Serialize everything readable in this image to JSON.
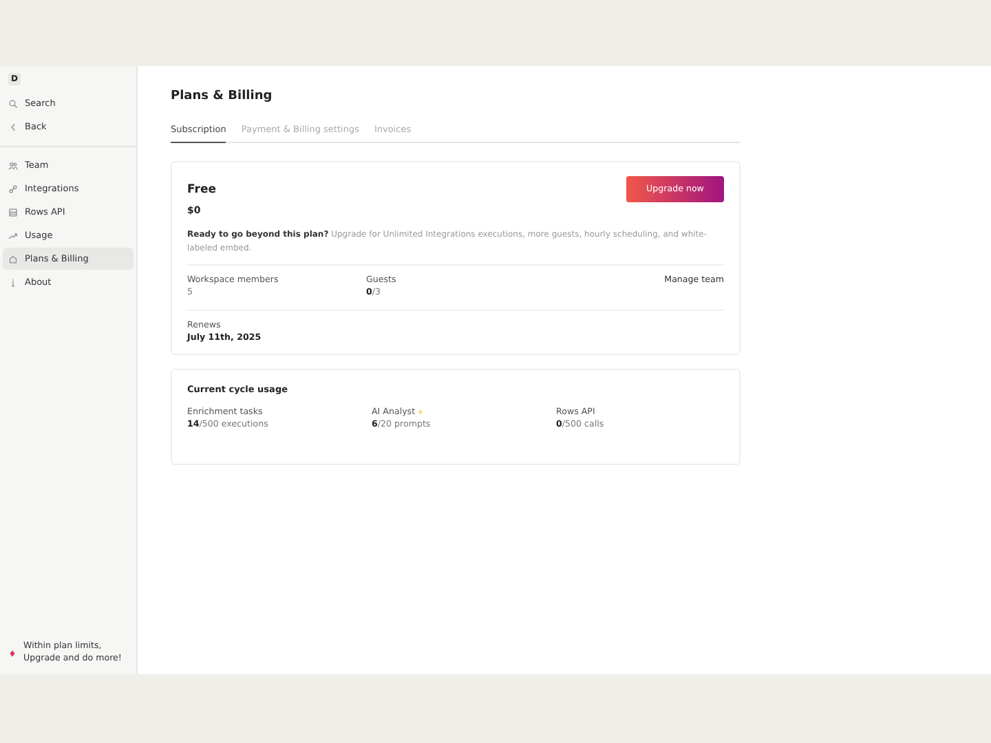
{
  "sidebar": {
    "workspace": "D",
    "top_items": [
      {
        "label": "Search"
      },
      {
        "label": "Back"
      }
    ],
    "items": [
      {
        "label": "Team",
        "selected": false
      },
      {
        "label": "Integrations",
        "selected": false
      },
      {
        "label": "Rows API",
        "selected": false
      },
      {
        "label": "Usage",
        "selected": false
      },
      {
        "label": "Plans & Billing",
        "selected": true
      },
      {
        "label": "About",
        "selected": false
      }
    ],
    "notice": "Within plan limits,\nUpgrade and do more!"
  },
  "page": {
    "title": "Plans & Billing",
    "tabs": [
      {
        "label": "Subscription",
        "selected": true
      },
      {
        "label": "Payment & Billing settings",
        "selected": false
      },
      {
        "label": "Invoices",
        "selected": false
      }
    ],
    "plan": {
      "name": "Free",
      "price": "$0",
      "upgrade_button": "Upgrade now",
      "lead": "Ready to go beyond this plan?",
      "description": "Upgrade for Unlimited Integrations executions, more guests, hourly scheduling, and white-labeled embed.",
      "members_label": "Workspace members",
      "members": "5",
      "guests_label": "Guests",
      "guests": "**0**/3",
      "manage_link": "Manage team",
      "renews_label": "Renews",
      "renews": "July 11th, 2025"
    },
    "usage": {
      "title": "Current cycle usage",
      "items": [
        {
          "label": "Enrichment tasks",
          "value": "**14**/500 executions",
          "sparkle": false
        },
        {
          "label": "AI Analyst",
          "value": "**6**/20 prompts",
          "sparkle": true
        },
        {
          "label": "Rows API",
          "value": "**0**/500 calls",
          "sparkle": false
        }
      ]
    }
  }
}
